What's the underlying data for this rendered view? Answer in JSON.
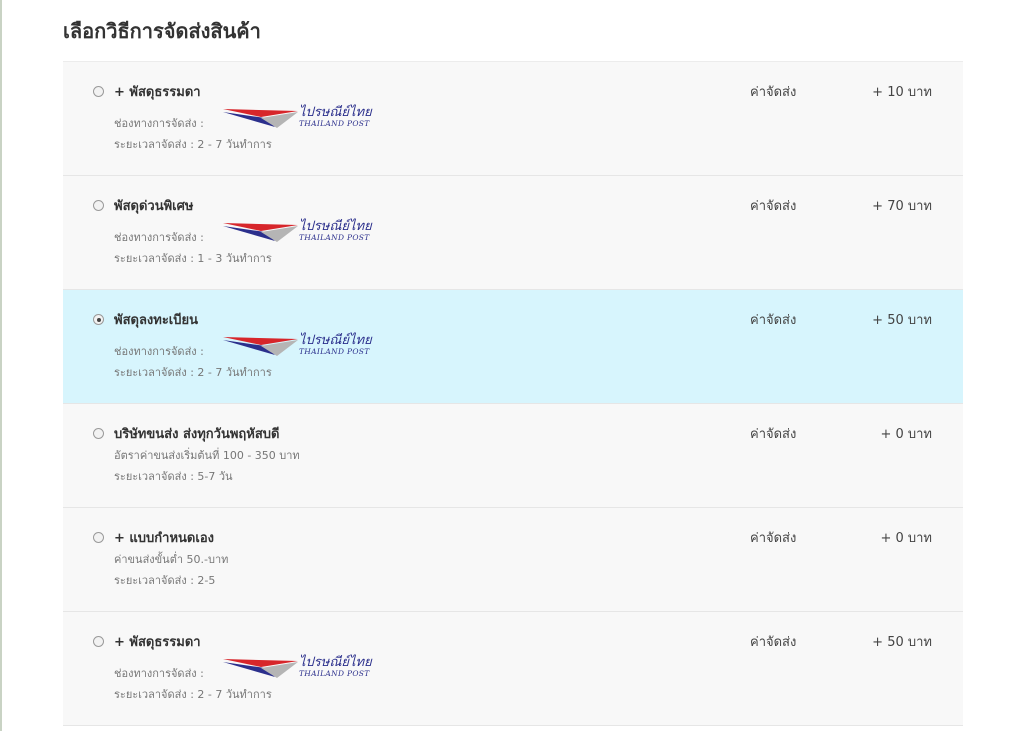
{
  "page": {
    "title": "เลือกวิธีการจัดส่งสินค้า"
  },
  "carrier_logo": {
    "thai": "ไปรษณีย์ไทย",
    "english": "THAILAND POST",
    "colors": {
      "red": "#d7262b",
      "blue": "#2b2f8c",
      "grey": "#b5b5b5"
    }
  },
  "colors": {
    "selected_background": "#d7f5fd",
    "row_background": "#f8f8f8"
  },
  "options": [
    {
      "title": "+ พัสดุธรรมดา",
      "channel_label": "ช่องทางการจัดส่ง :",
      "duration": "ระยะเวลาจัดส่ง :   2 - 7 วันทำการ",
      "fee_label": "ค่าจัดส่ง",
      "fee": "+ 10 บาท",
      "selected": false
    },
    {
      "title": "พัสดุด่วนพิเศษ",
      "channel_label": "ช่องทางการจัดส่ง :",
      "duration": "ระยะเวลาจัดส่ง :   1 - 3 วันทำการ",
      "fee_label": "ค่าจัดส่ง",
      "fee": "+ 70 บาท",
      "selected": false
    },
    {
      "title": "พัสดุลงทะเบียน",
      "channel_label": "ช่องทางการจัดส่ง :",
      "duration": "ระยะเวลาจัดส่ง :   2 - 7 วันทำการ",
      "fee_label": "ค่าจัดส่ง",
      "fee": "+ 50 บาท",
      "selected": true
    },
    {
      "title": "บริษัทขนส่ง ส่งทุกวันพฤหัสบดี",
      "note": "อัตราค่าขนส่งเริ่มต้นที่ 100 - 350 บาท",
      "duration": "ระยะเวลาจัดส่ง :   5-7 วัน",
      "fee_label": "ค่าจัดส่ง",
      "fee": "+ 0 บาท",
      "selected": false
    },
    {
      "title": "+ แบบกำหนดเอง",
      "note": "ค่าขนส่งขั้นต่ำ 50.-บาท",
      "duration": "ระยะเวลาจัดส่ง :   2-5",
      "fee_label": "ค่าจัดส่ง",
      "fee": "+ 0 บาท",
      "selected": false
    },
    {
      "title": "+ พัสดุธรรมดา",
      "channel_label": "ช่องทางการจัดส่ง :",
      "duration": "ระยะเวลาจัดส่ง :   2 - 7 วันทำการ",
      "fee_label": "ค่าจัดส่ง",
      "fee": "+ 50 บาท",
      "selected": false
    }
  ]
}
